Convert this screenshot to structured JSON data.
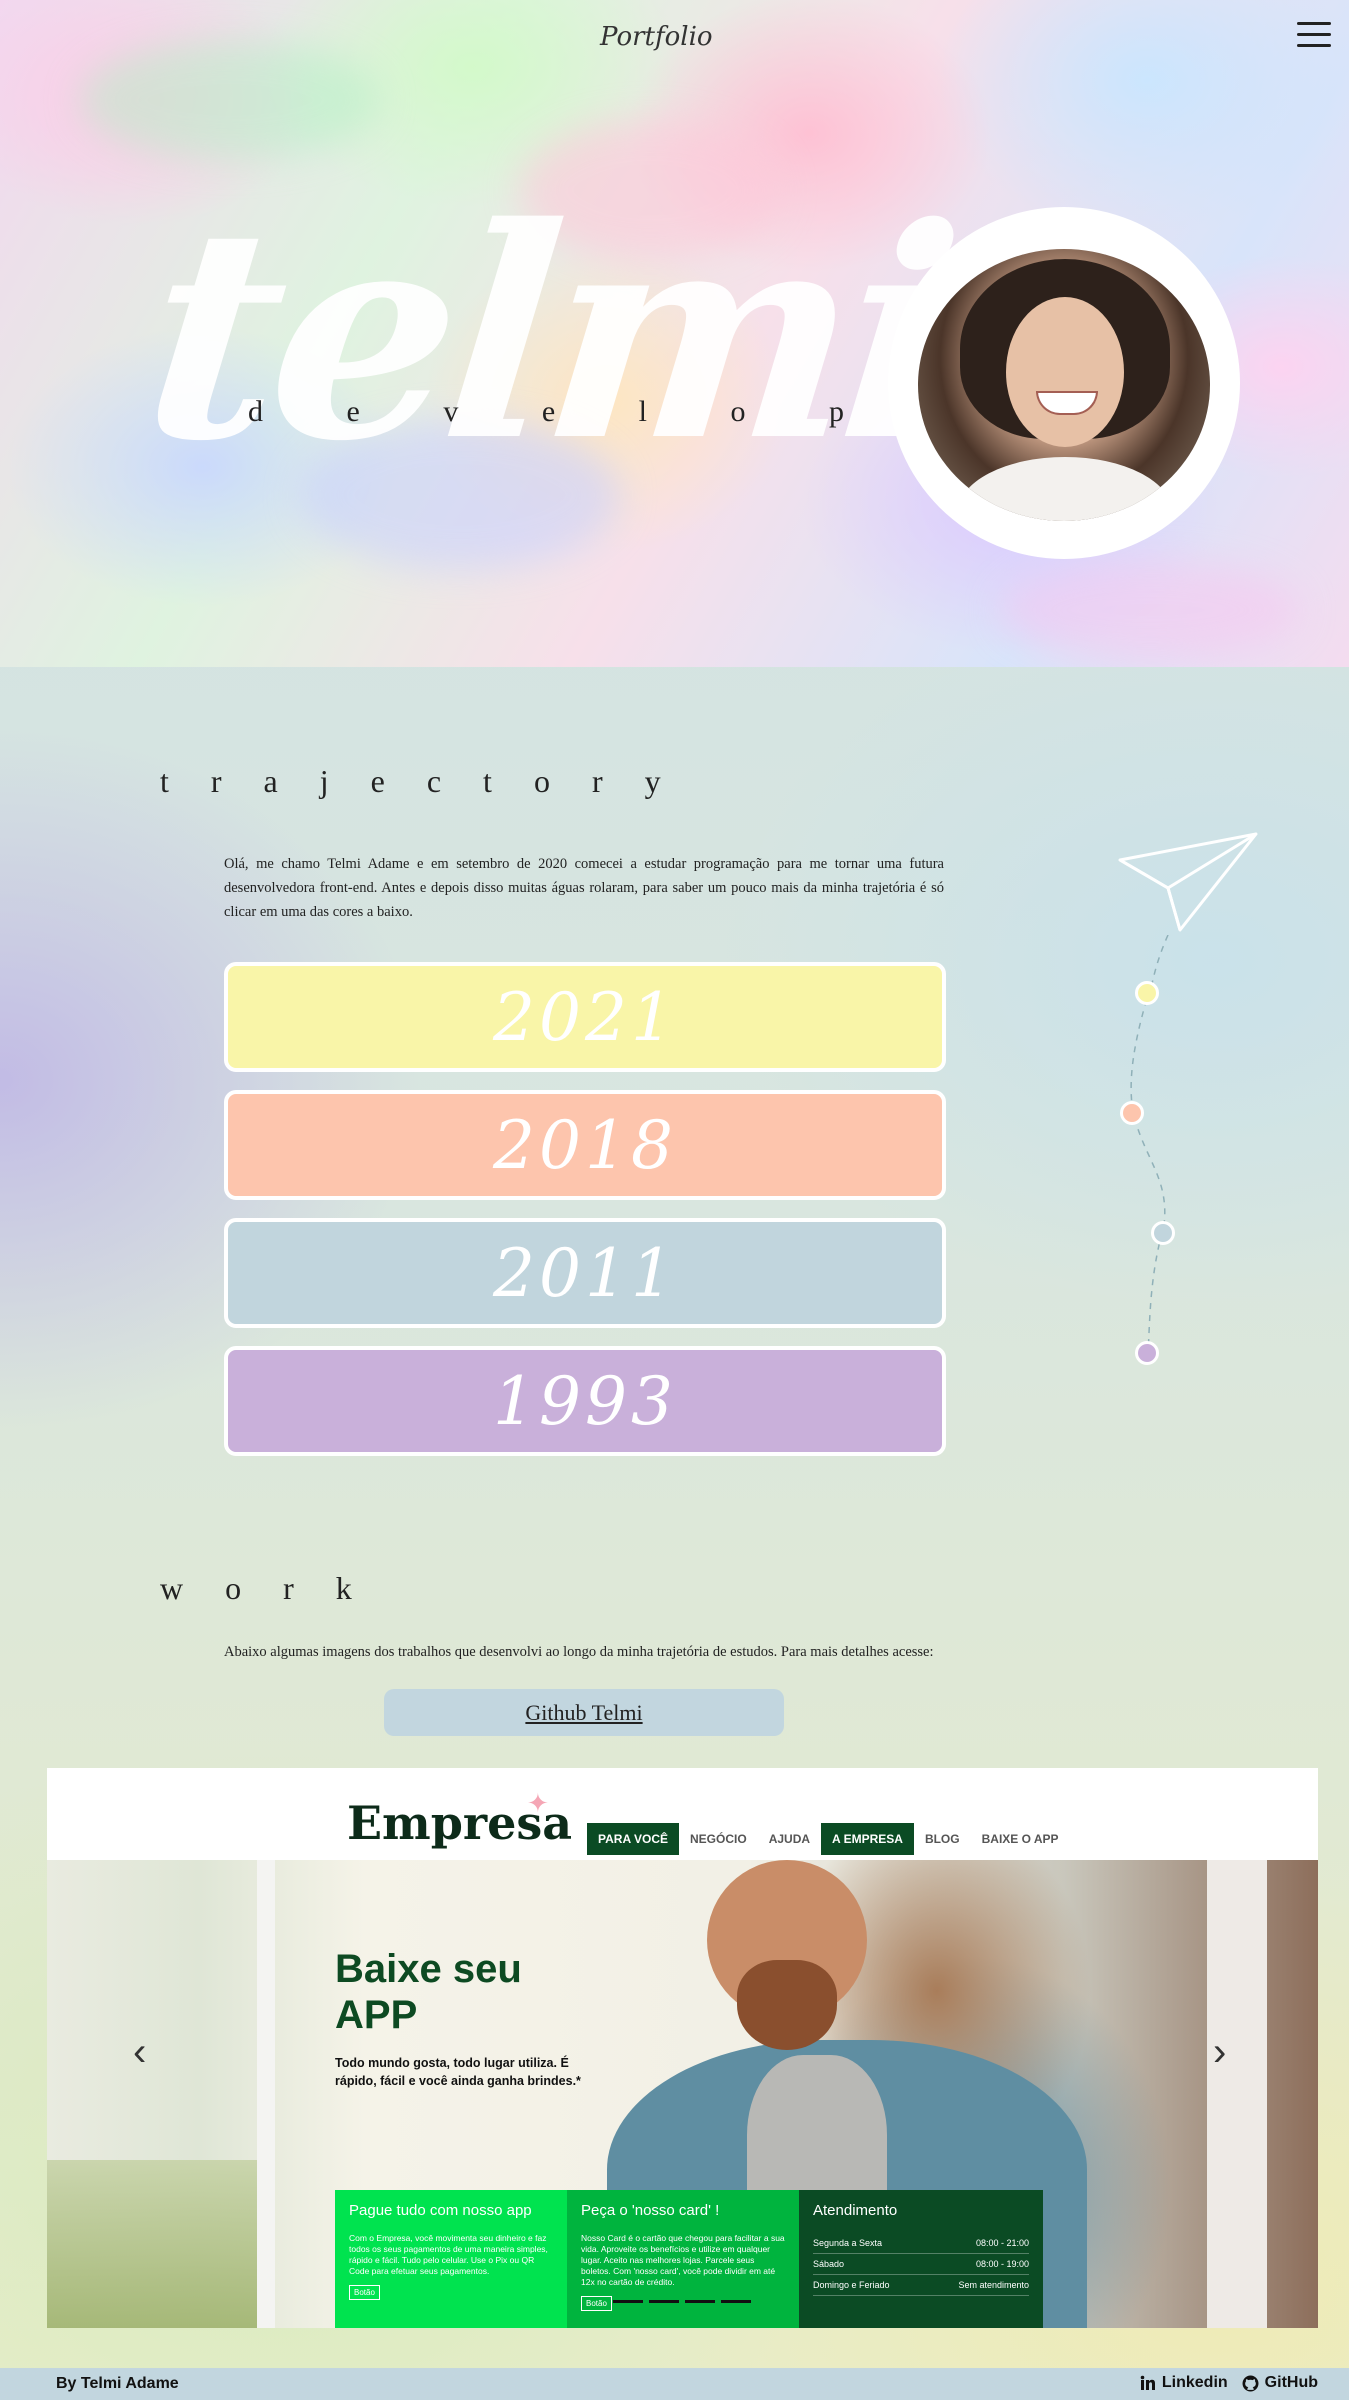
{
  "header": {
    "portfolio_label": "Portfolio",
    "menu_icon": "hamburger-menu-icon"
  },
  "hero": {
    "name": "telmi",
    "role": "d e v e l o p e r"
  },
  "trajectory": {
    "title": "t r a j e c t o r y",
    "intro": "Olá, me chamo Telmi Adame e em setembro de 2020 comecei a estudar programação para me tornar uma futura desenvolvedora front-end. Antes e depois disso muitas águas rolaram, para saber um pouco mais da minha trajetória é só clicar em uma das cores a baixo.",
    "years": [
      {
        "label": "2021",
        "color": "#f9f5a8"
      },
      {
        "label": "2018",
        "color": "#fdc5ad"
      },
      {
        "label": "2011",
        "color": "#c1d5dd"
      },
      {
        "label": "1993",
        "color": "#c9b0da"
      }
    ]
  },
  "work": {
    "title": "w o r k",
    "intro": "Abaixo algumas imagens dos trabalhos que desenvolvi ao longo da minha trajetória de estudos. Para mais detalhes acesse:",
    "github_label": "Github Telmi"
  },
  "project": {
    "logo": "Empresa",
    "nav": [
      "PARA VOCÊ",
      "NEGÓCIO",
      "AJUDA",
      "A EMPRESA",
      "BLOG",
      "BAIXE O APP"
    ],
    "hero_title": "Baixe seu APP",
    "hero_sub": "Todo mundo gosta, todo lugar utiliza. É rápido, fácil e você ainda ganha brindes.*",
    "card1": {
      "title": "Pague tudo com nosso app",
      "text": "Com o Empresa, você movimenta seu dinheiro e faz todos os seus pagamentos de uma maneira simples, rápido e fácil. Tudo pelo celular. Use o Pix ou QR Code para efetuar seus pagamentos.",
      "button": "Botão",
      "color": "#00e34f"
    },
    "card2": {
      "title": "Peça o 'nosso card' !",
      "text": "Nosso Card é o cartão que chegou para facilitar a sua vida. Aproveite os benefícios e utilize em qualquer lugar. Aceito nas melhores lojas. Parcele seus boletos. Com 'nosso card', você pode dividir em até 12x no cartão de crédito.",
      "button": "Botão",
      "color": "#00b43e"
    },
    "card3": {
      "title": "Atendimento",
      "rows": [
        {
          "day": "Segunda a Sexta",
          "hours": "08:00 - 21:00"
        },
        {
          "day": "Sábado",
          "hours": "08:00 - 19:00"
        },
        {
          "day": "Domingo e Feriado",
          "hours": "Sem atendimento"
        }
      ],
      "color": "#0b4b24"
    }
  },
  "footer": {
    "author": "By Telmi Adame",
    "linkedin": "Linkedin",
    "github": "GitHub"
  }
}
